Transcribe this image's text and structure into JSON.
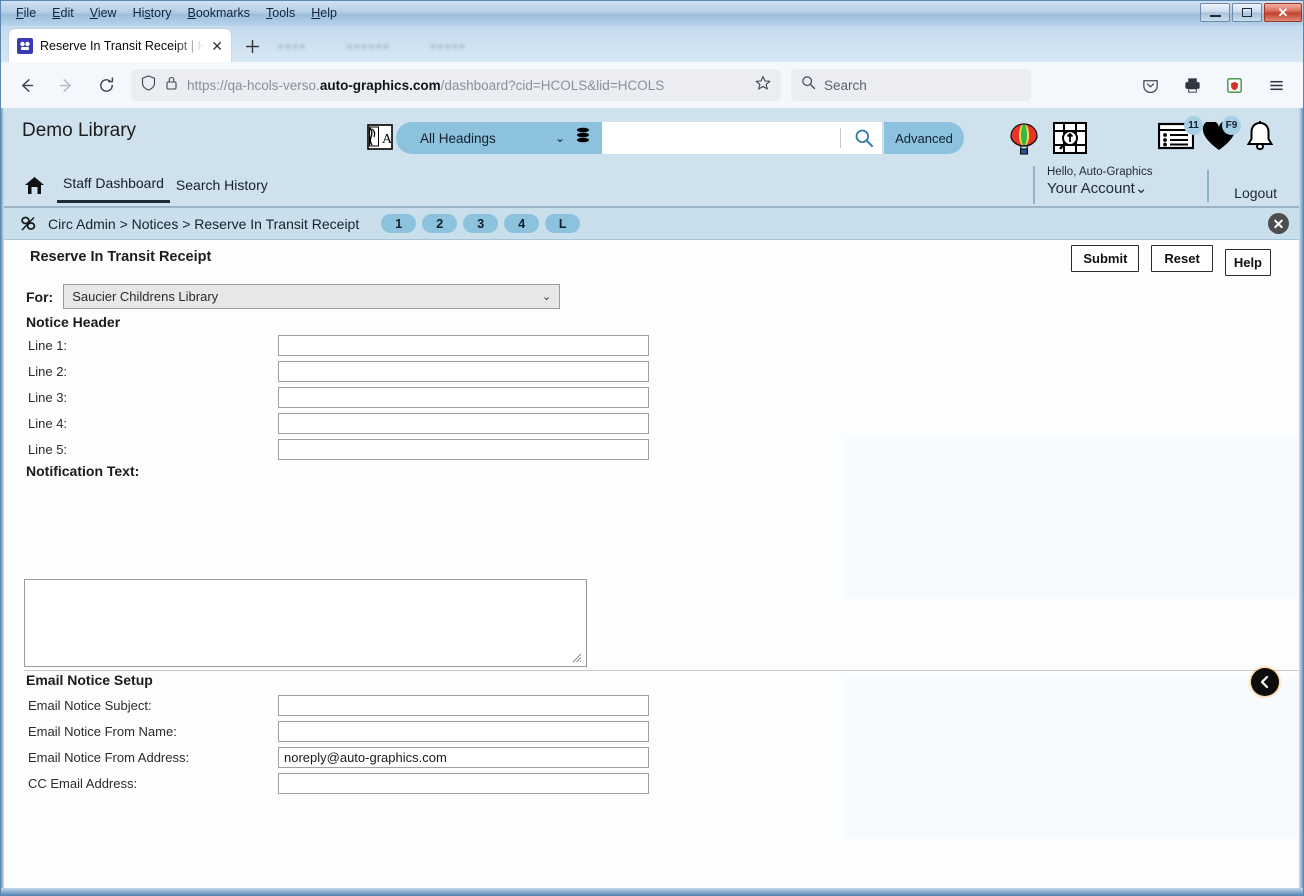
{
  "window": {
    "menus": [
      {
        "label": "File",
        "accel": "F"
      },
      {
        "label": "Edit",
        "accel": "E"
      },
      {
        "label": "View",
        "accel": "V"
      },
      {
        "label": "History",
        "accel": "s"
      },
      {
        "label": "Bookmarks",
        "accel": "B"
      },
      {
        "label": "Tools",
        "accel": "T"
      },
      {
        "label": "Help",
        "accel": "H"
      }
    ],
    "controls": {
      "minimize_label": "—",
      "maximize_label": "□",
      "close_label": "✕"
    }
  },
  "browser": {
    "tab": {
      "title": "Reserve In Transit Receipt | HCO",
      "close_label": "✕",
      "favicon_label": "ag"
    },
    "new_tab_label": "+",
    "toolbar": {
      "back_label": "←",
      "forward_label": "→",
      "reload_label": "⟳",
      "bookmark_label": "☆",
      "pocket_label": "save-to-pocket",
      "print_label": "print",
      "extension_label": "extension",
      "menu_label": "≡"
    },
    "url": {
      "prefix": "https://qa-hcols-verso.",
      "domain": "auto-graphics.com",
      "suffix": "/dashboard?cid=HCOLS&lid=HCOLS"
    },
    "search": {
      "placeholder": "Search"
    }
  },
  "app": {
    "library_name": "Demo Library",
    "scope": {
      "selected": "All Headings",
      "caret": "⌄"
    },
    "search_value": "",
    "advanced_label": "Advanced",
    "icons": {
      "language": "language-translate-icon",
      "database": "database-icon",
      "magnifier": "search-icon",
      "balloon": "hot-air-balloon-icon",
      "browse": "browse-shelf-icon",
      "list": "my-lists-icon",
      "heart": "favorites-icon",
      "bell": "notifications-icon"
    },
    "badges": {
      "list_count": "11",
      "heart_count": "F9"
    },
    "nav": [
      {
        "label": "Staff Dashboard",
        "active": true
      },
      {
        "label": "Search History",
        "active": false
      }
    ],
    "account": {
      "greeting": "Hello, Auto-Graphics",
      "label": "Your Account",
      "caret": "⌄",
      "logout": "Logout"
    }
  },
  "breadcrumb": {
    "text": "Circ Admin > Notices > Reserve In Transit Receipt",
    "steps": [
      "1",
      "2",
      "3",
      "4",
      "L"
    ],
    "close_label": "✕"
  },
  "form": {
    "title": "Reserve In Transit Receipt",
    "actions": {
      "submit": "Submit",
      "reset": "Reset",
      "help": "Help"
    },
    "for": {
      "label": "For:",
      "value": "Saucier Childrens Library",
      "caret": "⌄"
    },
    "notice_header": {
      "title": "Notice Header",
      "lines": [
        {
          "label": "Line 1:",
          "value": ""
        },
        {
          "label": "Line 2:",
          "value": ""
        },
        {
          "label": "Line 3:",
          "value": ""
        },
        {
          "label": "Line 4:",
          "value": ""
        },
        {
          "label": "Line 5:",
          "value": ""
        }
      ]
    },
    "notification_text": {
      "label": "Notification Text:",
      "value": ""
    },
    "email_setup": {
      "title": "Email Notice Setup",
      "fields": [
        {
          "label": "Email Notice Subject:",
          "value": ""
        },
        {
          "label": "Email Notice From Name:",
          "value": ""
        },
        {
          "label": "Email Notice From Address:",
          "value": "noreply@auto-graphics.com"
        },
        {
          "label": "CC Email Address:",
          "value": ""
        }
      ]
    },
    "back_button_label": "❮"
  },
  "colors": {
    "header_blue": "#cfe1ec",
    "accent_blue": "#8cc2dd",
    "crumb_blue": "#c9dfeb",
    "page_bg": "#fbfdff"
  }
}
